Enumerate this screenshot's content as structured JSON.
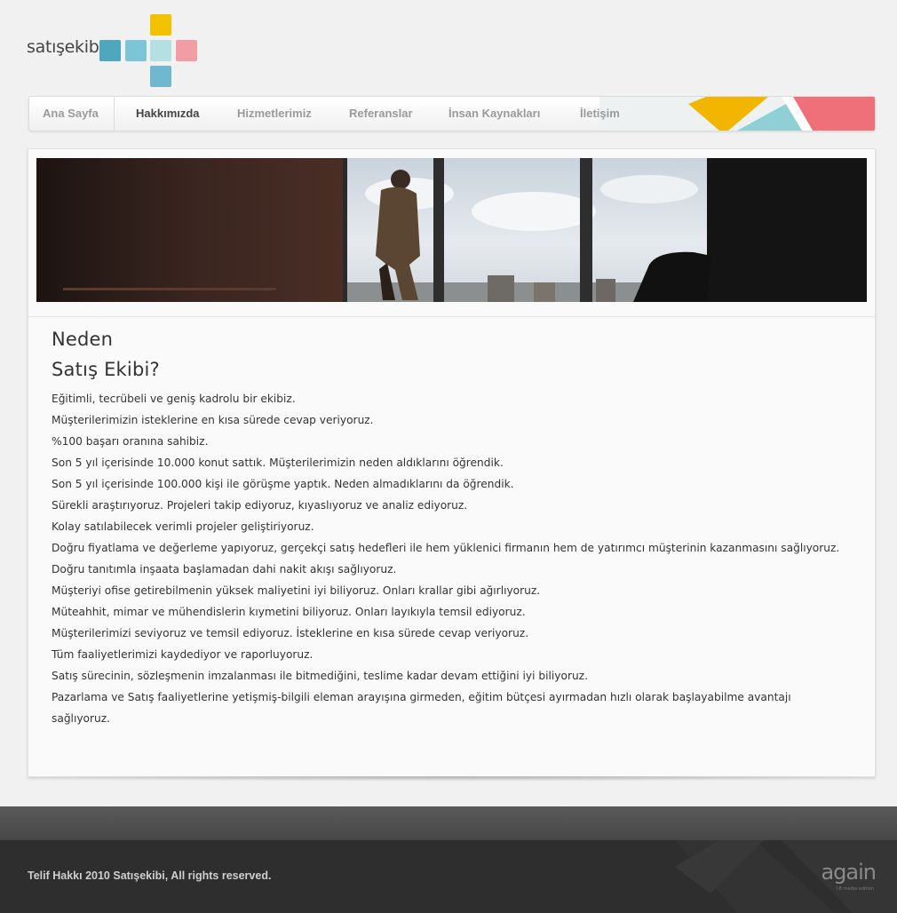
{
  "brand": {
    "name": "satışekibi",
    "square_colors": [
      "#f2c200",
      "#4fa7bd",
      "#7cc5d6",
      "#b5e0e3",
      "#f29ca3",
      "#6fb8cf"
    ]
  },
  "nav": {
    "items": [
      {
        "label": "Ana Sayfa",
        "active": false
      },
      {
        "label": "Hakkımızda",
        "active": true
      },
      {
        "label": "Hizmetlerimiz",
        "active": false
      },
      {
        "label": "Referanslar",
        "active": false
      },
      {
        "label": "İnsan Kaynakları",
        "active": false
      },
      {
        "label": "İletişim",
        "active": false
      }
    ],
    "accent_colors": [
      "#f2b600",
      "#8fd0d6",
      "#ef6f78"
    ]
  },
  "content": {
    "heading_line1": "Neden",
    "heading_line2": "Satış Ekibi?",
    "lines": [
      " Eğitimli, tecrübeli ve geniş kadrolu bir ekibiz.",
      "Müşterilerimizin isteklerine en kısa sürede cevap veriyoruz.",
      "%100 başarı oranına sahibiz.",
      "Son 5 yıl içerisinde 10.000 konut sattık. Müşterilerimizin neden aldıklarını öğrendik.",
      "Son 5 yıl içerisinde 100.000 kişi ile görüşme yaptık. Neden almadıklarını da öğrendik.",
      "Sürekli araştırıyoruz. Projeleri takip ediyoruz, kıyaslıyoruz ve analiz ediyoruz.",
      "Kolay satılabilecek verimli projeler geliştiriyoruz.",
      "Doğru fiyatlama ve değerleme yapıyoruz, gerçekçi satış hedefleri ile hem yüklenici firmanın hem de yatırımcı müşterinin kazanmasını sağlıyoruz.",
      "Doğru tanıtımla inşaata başlamadan dahi nakit akışı sağlıyoruz.",
      "Müşteriyi ofise getirebilmenin yüksek maliyetini iyi biliyoruz. Onları krallar gibi ağırlıyoruz.",
      "Müteahhit, mimar ve mühendislerin kıymetini biliyoruz. Onları layıkıyla temsil ediyoruz.",
      "Müşterilerimizi seviyoruz ve temsil ediyoruz. İsteklerine en kısa sürede cevap veriyoruz.",
      "Tüm faaliyetlerimizi kaydediyor ve raporluyoruz.",
      "Satış sürecinin, sözleşmenin imzalanması ile bitmediğini, teslime kadar devam ettiğini iyi biliyoruz.",
      "Pazarlama ve Satış faaliyetlerine yetişmiş-bilgili eleman arayışına girmeden, eğitim bütçesi ayırmadan hızlı olarak başlayabilme avantajı",
      "sağlıyoruz."
    ]
  },
  "footer": {
    "copyright": "Telif Hakkı 2010 Satışekibi, All rights reserved.",
    "logo_text": "again",
    "logo_sub": "İ-B media edition"
  }
}
